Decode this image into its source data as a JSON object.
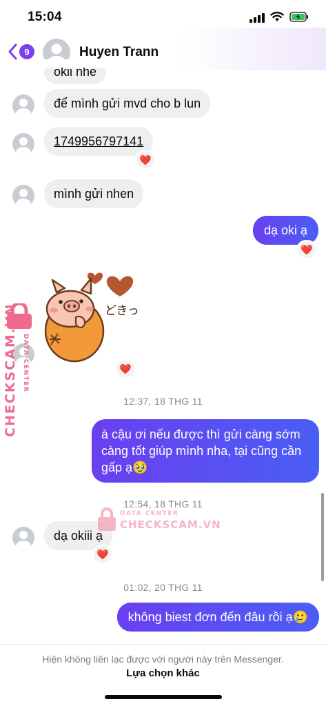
{
  "status_bar": {
    "time": "15:04"
  },
  "header": {
    "unread_count": "9",
    "contact_name": "Huyen Trann"
  },
  "messages": {
    "m1": "okii nhe",
    "m2": "để mình gửi mvd cho b lun",
    "m3": "1749956797141",
    "m4": "mình gửi nhen",
    "m5": "dạ oki ạ",
    "m7": "à cậu ơi nếu được thì gửi càng sớm càng tốt giúp mình nha, tại cũng cần gấp ạ🥹",
    "m8": "dạ okiii ạ",
    "m9": "không biest đơn đến đâu rồi ạ🥲"
  },
  "reaction": "❤️",
  "timestamps": [
    "12:37, 18 THG 11",
    "12:54, 18 THG 11",
    "01:02, 20 THG 11"
  ],
  "sticker": {
    "text": "どきっ"
  },
  "watermark": {
    "label": "DATA CENTER",
    "brand": "CHECKSCAM.VN"
  },
  "footer": {
    "note": "Hiện không liên lạc được với người này trên Messenger.",
    "link": "Lựa chọn khác"
  },
  "colors": {
    "accent": "#7b3ff2",
    "outgoing": "#5b4cf0",
    "incoming": "#efefef",
    "watermark": "#f06a8f"
  }
}
